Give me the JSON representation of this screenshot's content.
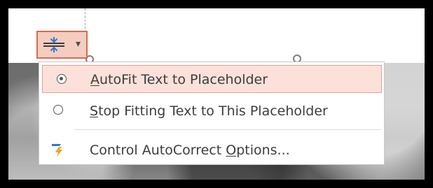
{
  "menu": {
    "items": [
      {
        "label_parts": [
          "",
          "A",
          "utoFit Text to Placeholder"
        ],
        "selected": true
      },
      {
        "label_parts": [
          "",
          "S",
          "top Fitting Text to This Placeholder"
        ],
        "selected": false
      },
      {
        "label_parts": [
          "Control AutoCorrect ",
          "O",
          "ptions..."
        ],
        "selected": false
      }
    ]
  },
  "icons": {
    "options": "autofit-options-icon",
    "dropdown": "dropdown-arrow-icon",
    "autocorrect": "autocorrect-lightning-icon"
  },
  "colors": {
    "highlight_border": "#d96a4e",
    "highlight_fill": "#fbe1d9",
    "icon_blue": "#2f75d6",
    "icon_orange": "#f0a230"
  }
}
